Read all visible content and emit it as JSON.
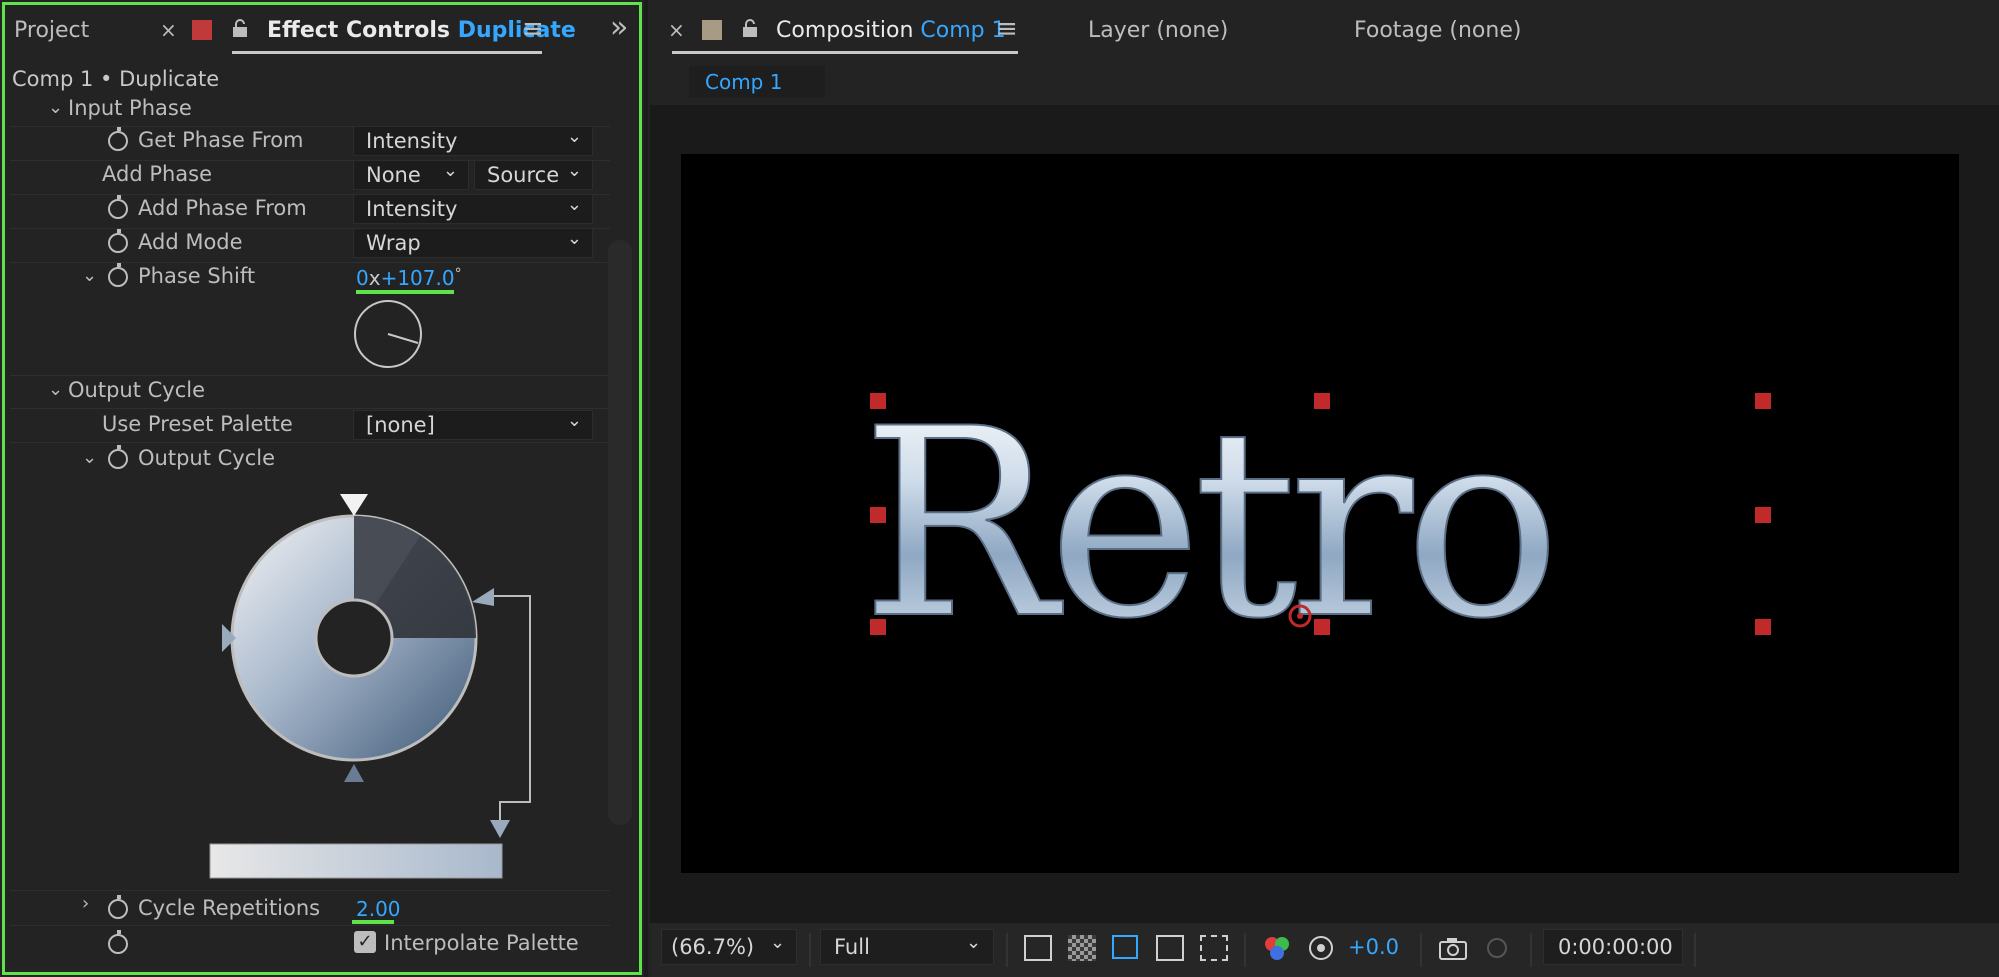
{
  "colors": {
    "accent_blue": "#35a7ff",
    "highlight_green": "#5fe34b",
    "handle_red": "#c02a2a"
  },
  "left": {
    "tabs": {
      "project": "Project",
      "close": "×",
      "effect_controls_prefix": "Effect Controls",
      "effect_controls_name": "Duplicate",
      "menu_icon": "≡",
      "overflow_icon": "»"
    },
    "breadcrumb": "Comp 1 • Duplicate",
    "input_phase": {
      "group_label": "Input Phase",
      "get_phase_from": {
        "label": "Get Phase From",
        "value": "Intensity"
      },
      "add_phase": {
        "label": "Add Phase",
        "value1": "None",
        "value2": "Source"
      },
      "add_phase_from": {
        "label": "Add Phase From",
        "value": "Intensity"
      },
      "add_mode": {
        "label": "Add Mode",
        "value": "Wrap"
      },
      "phase_shift": {
        "label": "Phase Shift",
        "value_rev": "0",
        "value_x": "x",
        "value_deg": "+107.0",
        "deg_sign": "°"
      }
    },
    "output_cycle": {
      "group_label": "Output Cycle",
      "use_preset_palette": {
        "label": "Use Preset Palette",
        "value": "[none]"
      },
      "output_cycle_label": "Output Cycle"
    },
    "cycle_repetitions": {
      "label": "Cycle Repetitions",
      "value": "2.00"
    },
    "interpolate_palette": {
      "label": "Interpolate Palette",
      "checked": true
    }
  },
  "right": {
    "tabs": {
      "close": "×",
      "composition_prefix": "Composition",
      "composition_name": "Comp 1",
      "menu_icon": "≡",
      "layer": "Layer (none)",
      "footage": "Footage (none)"
    },
    "comp_chip": "Comp 1",
    "canvas_text": "Retro",
    "bottom": {
      "zoom": "(66.7%)",
      "resolution": "Full",
      "exposure": "+0.0",
      "timecode": "0:00:00:00"
    }
  }
}
